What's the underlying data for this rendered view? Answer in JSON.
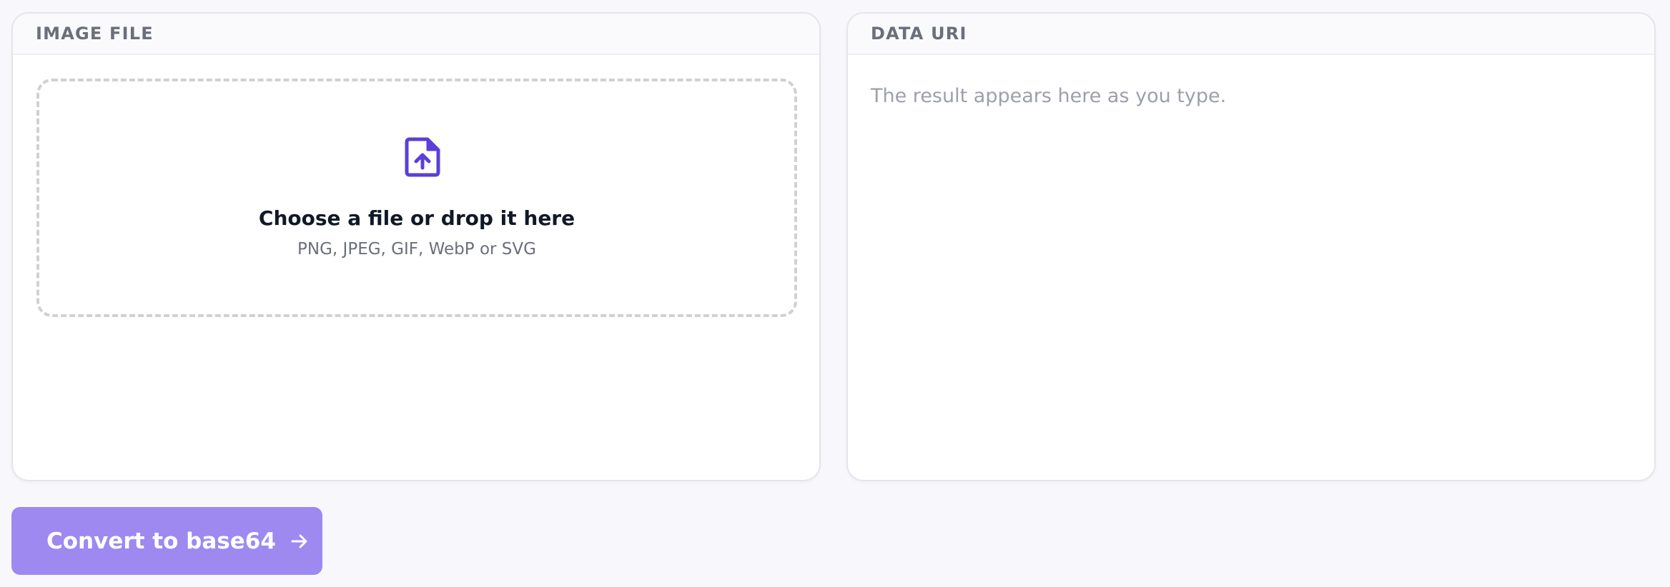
{
  "image_panel": {
    "header": "IMAGE FILE",
    "dropzone": {
      "icon": "file-upload-icon",
      "title": "Choose a file or drop it here",
      "hint": "PNG, JPEG, GIF, WebP or SVG"
    }
  },
  "output_panel": {
    "header": "DATA URI",
    "value": "",
    "placeholder": "The result appears here as you type."
  },
  "convert_button": {
    "label": "Convert to base64",
    "icon": "arrow-right-icon"
  },
  "colors": {
    "accent": "#5b3fd6",
    "button_background": "#9d89f0",
    "button_text": "#ffffff",
    "header_text": "#6b6f7b",
    "muted_text": "#9ca0aa",
    "border": "#e5e5ea",
    "dropzone_border": "#d0d0d6"
  }
}
